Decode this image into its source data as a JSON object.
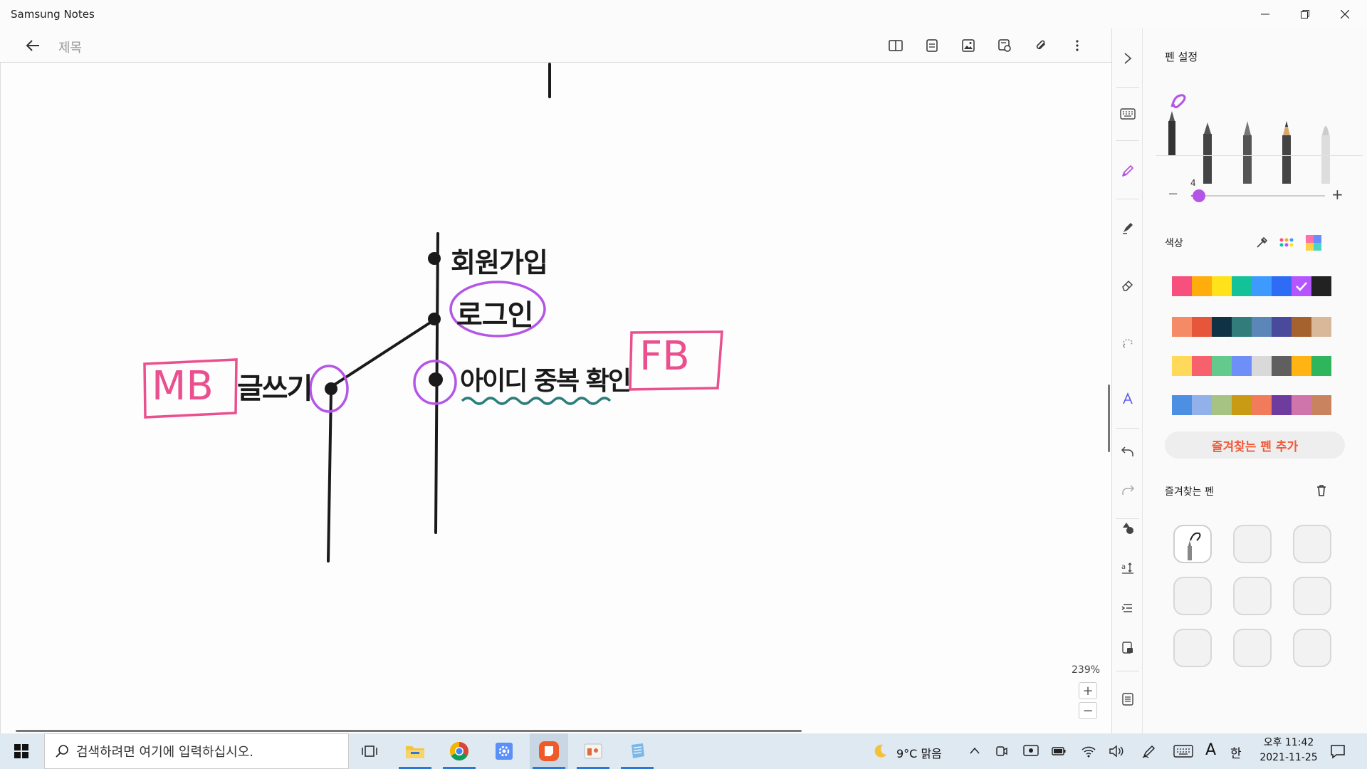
{
  "window": {
    "app_title": "Samsung Notes"
  },
  "toolbar": {
    "note_title": "제목"
  },
  "canvas": {
    "zoom": "239%",
    "annotations": {
      "word_1": "회원가입",
      "word_2": "로그인",
      "word_3": "글쓰기",
      "word_4": "아이디 중복 확인",
      "tag_mb": "MB",
      "tag_fb": "FB"
    }
  },
  "pen_panel": {
    "title": "펜 설정",
    "size_value": "4",
    "size_level": 0.06,
    "color_title": "색상",
    "add_favorite_label": "즐겨찾는 펜 추가",
    "favorites_title": "즐겨찾는 펜",
    "selected_color": "#b455ff",
    "palette": [
      [
        "#f7507f",
        "#ffad0d",
        "#ffe21a",
        "#14c29a",
        "#3d9bff",
        "#2f6cf5",
        "#b455ff",
        "#222222"
      ],
      [
        "#f58a67",
        "#e5563b",
        "#0f3245",
        "#337c7c",
        "#5b86b8",
        "#4a4a9c",
        "#a5612e",
        "#d8b898"
      ],
      [
        "#ffd95a",
        "#f7606d",
        "#64c98c",
        "#6e8ff7",
        "#d9d9d9",
        "#5f5f5f",
        "#ffb414",
        "#2fb55b"
      ],
      [
        "#4d8fe3",
        "#92b1ea",
        "#a6c383",
        "#c99a14",
        "#f17b5a",
        "#6d3c9e",
        "#d074ac",
        "#c9835f"
      ]
    ]
  },
  "taskbar": {
    "search_placeholder": "검색하려면 여기에 입력하십시오.",
    "weather": "9°C  맑음",
    "ime": "한",
    "ime_font": "A",
    "time": "오후 11:42",
    "date": "2021-11-25"
  }
}
